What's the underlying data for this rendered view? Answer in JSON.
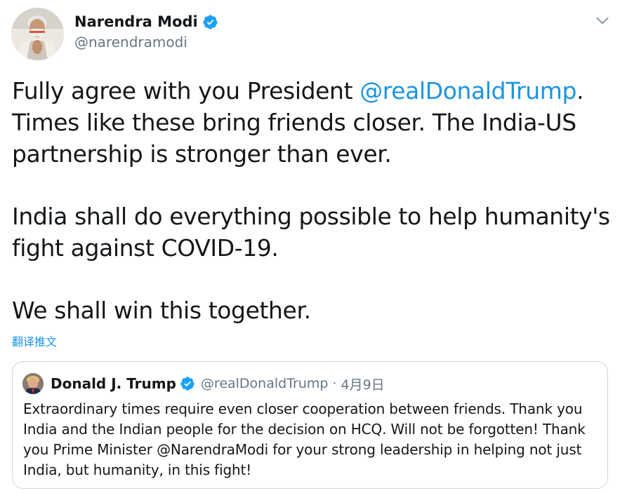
{
  "tweet": {
    "author_name": "Narendra Modi",
    "author_handle": "@narendramodi",
    "verified_icon": "verified-badge-icon",
    "caret_icon": "chevron-down-icon",
    "text": {
      "p1_before": "Fully agree with you President ",
      "p1_mention": "@realDonaldTrump",
      "p1_after": ". Times like these bring friends closer. The India-US partnership is stronger than ever.",
      "p2": "India shall do everything possible to help humanity's fight against COVID-19.",
      "p3": "We shall win this together."
    },
    "translate_label": "翻译推文"
  },
  "quoted_tweet": {
    "author_name": "Donald J. Trump",
    "author_handle": "@realDonaldTrump",
    "separator": "·",
    "date": "4月9日",
    "text": "Extraordinary times require even closer cooperation between friends. Thank you India and the Indian people for the decision on HCQ. Will not be forgotten! Thank you Prime Minister @NarendraModi for your strong leadership in helping not just India, but humanity, in this fight!"
  },
  "colors": {
    "link": "#1b95e0",
    "secondary_text": "#657786",
    "border": "#ccd6dd",
    "verified": "#1da1f2"
  }
}
